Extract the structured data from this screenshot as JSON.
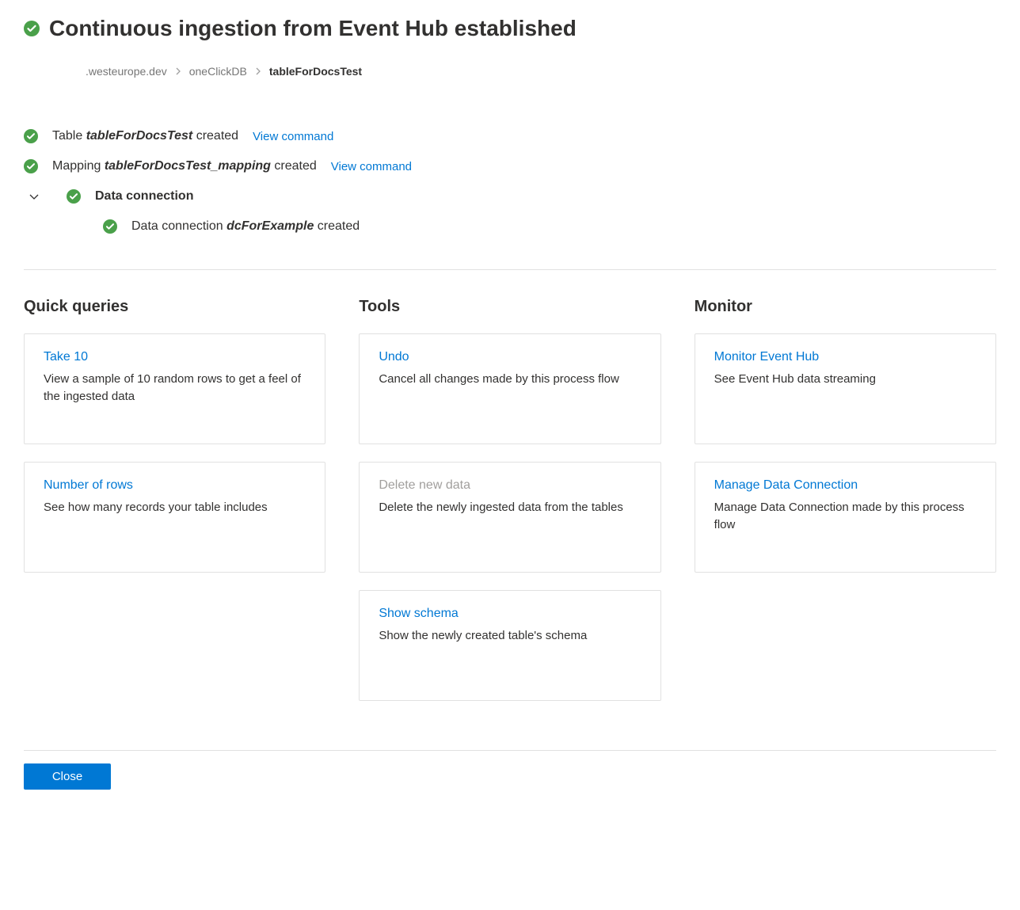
{
  "header": {
    "title": "Continuous ingestion from Event Hub established"
  },
  "breadcrumb": {
    "cluster": ".westeurope.dev",
    "database": "oneClickDB",
    "table": "tableForDocsTest"
  },
  "status": {
    "table_created": {
      "pre": "Table ",
      "name": "tableForDocsTest",
      "post": " created",
      "link": "View command"
    },
    "mapping_created": {
      "pre": "Mapping ",
      "name": "tableForDocsTest_mapping",
      "post": " created",
      "link": "View command"
    },
    "data_connection": {
      "heading": "Data connection",
      "child": {
        "pre": "Data connection ",
        "name": "dcForExample",
        "post": " created"
      }
    }
  },
  "sections": {
    "quick_queries": {
      "title": "Quick queries",
      "cards": [
        {
          "title": "Take 10",
          "desc": "View a sample of 10 random rows to get a feel of the ingested data",
          "disabled": false
        },
        {
          "title": "Number of rows",
          "desc": "See how many records your table includes",
          "disabled": false
        }
      ]
    },
    "tools": {
      "title": "Tools",
      "cards": [
        {
          "title": "Undo",
          "desc": "Cancel all changes made by this process flow",
          "disabled": false
        },
        {
          "title": "Delete new data",
          "desc": "Delete the newly ingested data from the tables",
          "disabled": true
        },
        {
          "title": "Show schema",
          "desc": "Show the newly created table's schema",
          "disabled": false
        }
      ]
    },
    "monitor": {
      "title": "Monitor",
      "cards": [
        {
          "title": "Monitor Event Hub",
          "desc": "See Event Hub data streaming",
          "disabled": false
        },
        {
          "title": "Manage Data Connection",
          "desc": "Manage Data Connection made by this process flow",
          "disabled": false
        }
      ]
    }
  },
  "footer": {
    "close_label": "Close"
  },
  "icons": {
    "check": "success-circle-check"
  }
}
